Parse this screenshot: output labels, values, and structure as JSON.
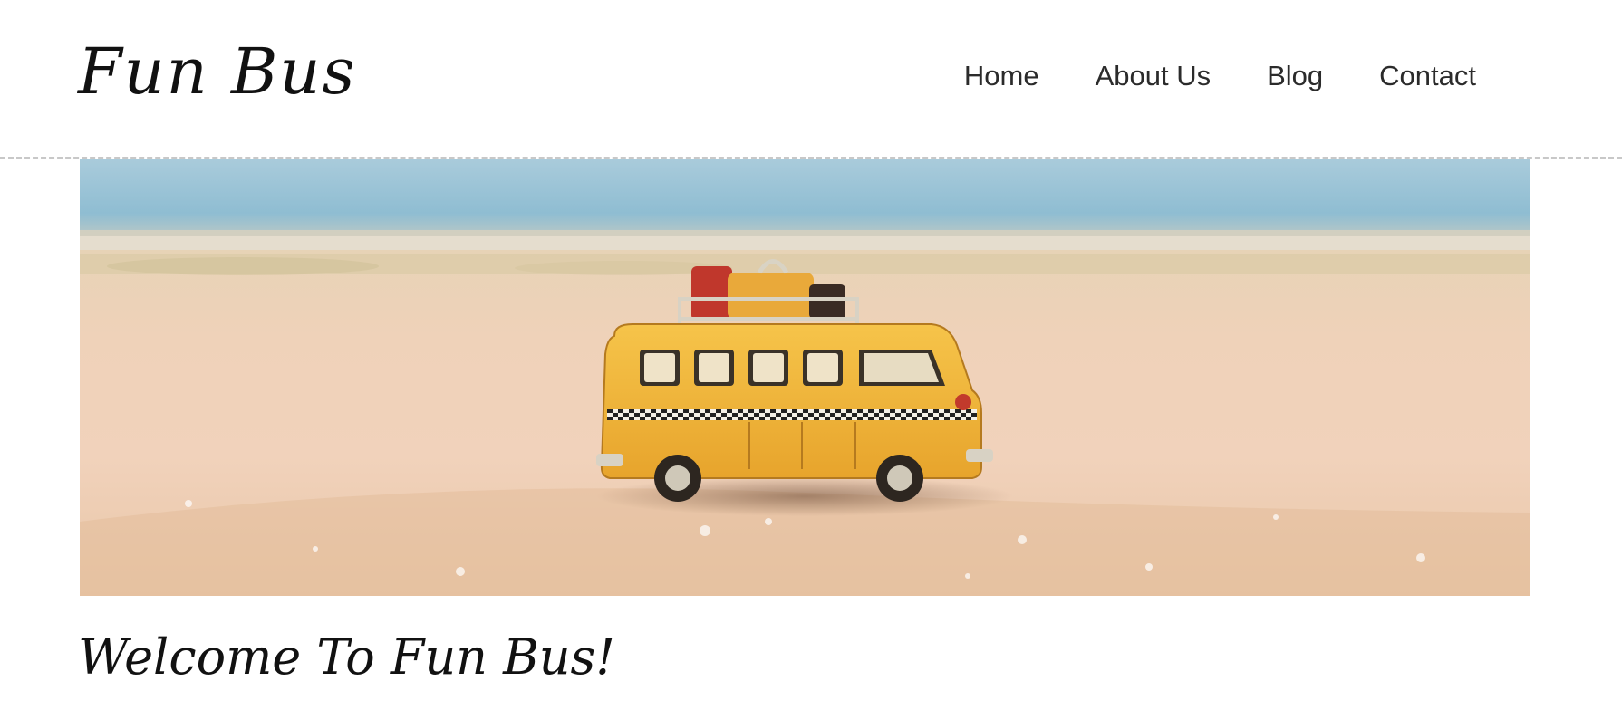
{
  "site": {
    "logo_text": "Fun Bus"
  },
  "nav": {
    "items": [
      {
        "label": "Home"
      },
      {
        "label": "About Us"
      },
      {
        "label": "Blog"
      },
      {
        "label": "Contact"
      }
    ]
  },
  "hero": {
    "subject": "toy yellow bus with luggage on a sandy beach"
  },
  "main": {
    "heading": "Welcome To Fun Bus!"
  },
  "colors": {
    "text": "#111111",
    "nav_text": "#2b2b2b",
    "divider": "#c8c8c8",
    "sky": "#9cc6d8",
    "sand": "#efd3b8",
    "bus_yellow": "#f2b63a"
  }
}
